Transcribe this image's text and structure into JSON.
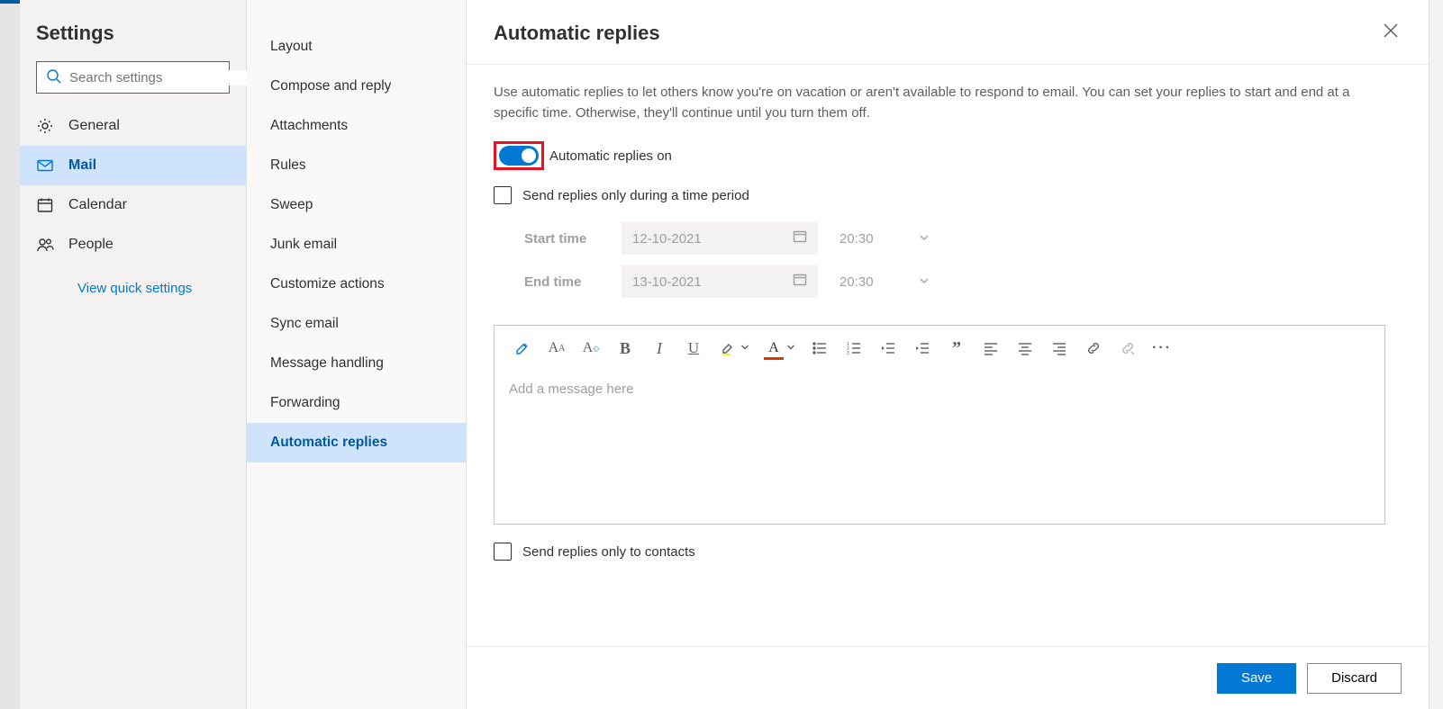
{
  "sidebar": {
    "title": "Settings",
    "search_placeholder": "Search settings",
    "items": [
      {
        "label": "General"
      },
      {
        "label": "Mail"
      },
      {
        "label": "Calendar"
      },
      {
        "label": "People"
      }
    ],
    "quick_link": "View quick settings"
  },
  "subnav": {
    "items": [
      "Layout",
      "Compose and reply",
      "Attachments",
      "Rules",
      "Sweep",
      "Junk email",
      "Customize actions",
      "Sync email",
      "Message handling",
      "Forwarding",
      "Automatic replies"
    ],
    "active_index": 10
  },
  "main": {
    "title": "Automatic replies",
    "intro": "Use automatic replies to let others know you're on vacation or aren't available to respond to email. You can set your replies to start and end at a specific time. Otherwise, they'll continue until you turn them off.",
    "toggle_label": "Automatic replies on",
    "toggle_on": true,
    "checkbox_period": "Send replies only during a time period",
    "start_label": "Start time",
    "end_label": "End time",
    "start_date": "12-10-2021",
    "end_date": "13-10-2021",
    "start_time": "20:30",
    "end_time": "20:30",
    "editor_placeholder": "Add a message here",
    "checkbox_contacts": "Send replies only to contacts"
  },
  "footer": {
    "save": "Save",
    "discard": "Discard"
  }
}
